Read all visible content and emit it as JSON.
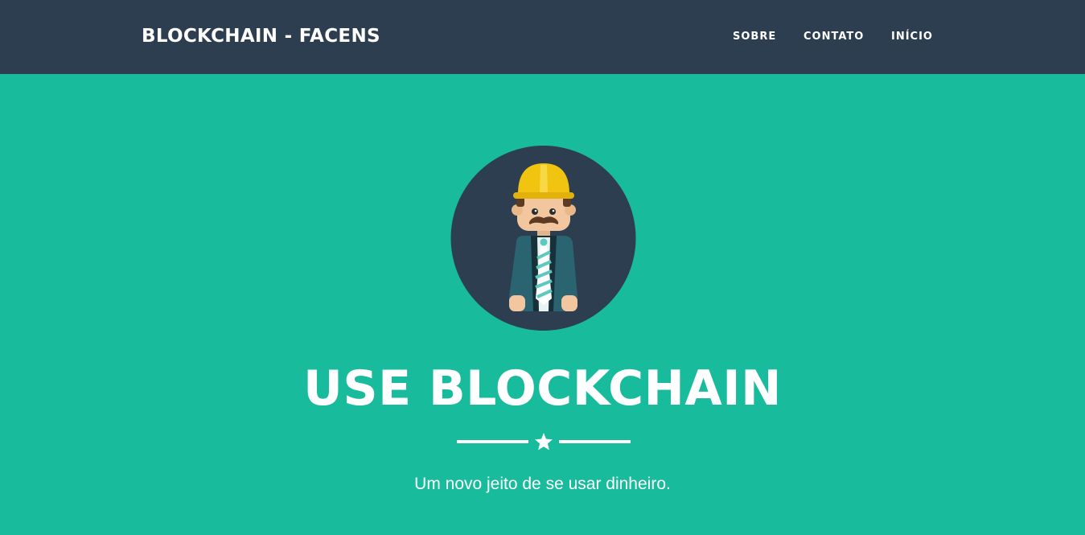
{
  "navbar": {
    "brand": "BLOCKCHAIN - FACENS",
    "links": [
      {
        "label": "SOBRE"
      },
      {
        "label": "CONTATO"
      },
      {
        "label": "INÍCIO"
      }
    ]
  },
  "hero": {
    "title": "USE BLOCKCHAIN",
    "divider_icon": "star-icon",
    "subtitle": "Um novo jeito de se usar dinheiro.",
    "avatar_icon": "engineer-avatar-icon"
  },
  "colors": {
    "navbar_bg": "#2c3e50",
    "hero_bg": "#18bc9c",
    "text": "#ffffff"
  }
}
